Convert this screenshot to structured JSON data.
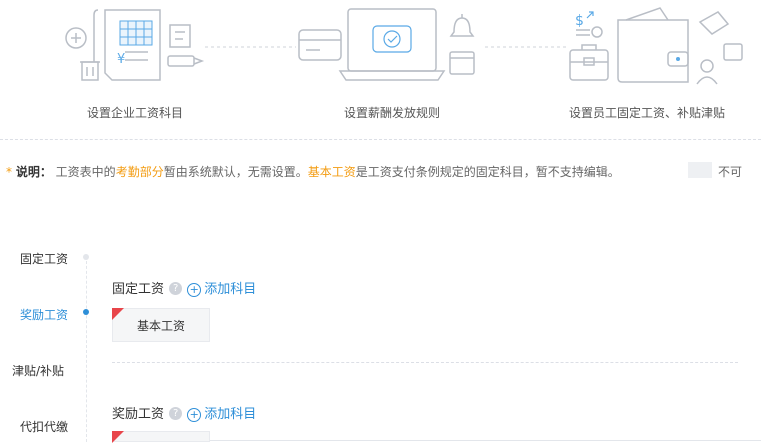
{
  "steps": [
    {
      "label": "设置企业工资科目"
    },
    {
      "label": "设置薪酬发放规则"
    },
    {
      "label": "设置员工固定工资、补贴津贴"
    }
  ],
  "note": {
    "star": "*",
    "label": "说明：",
    "p1": "工资表中的",
    "h1": "考勤部分",
    "p2": "暂由系统默认，无需设置。",
    "h2": "基本工资",
    "p3": "是工资支付条例规定的固定科目，暂不支持编辑。",
    "p4": "不可"
  },
  "sidebar": {
    "items": [
      {
        "label": "固定工资"
      },
      {
        "label": "奖励工资"
      },
      {
        "label": "津贴/补贴"
      },
      {
        "label": "代扣代缴"
      }
    ]
  },
  "sections": [
    {
      "title": "固定工资",
      "help": "?",
      "add_label": "添加科目",
      "tags": [
        "基本工资"
      ]
    },
    {
      "title": "奖励工资",
      "help": "?",
      "add_label": "添加科目",
      "tags": [
        ""
      ]
    }
  ],
  "colors": {
    "accent": "#2e8fd8",
    "highlight": "#f39c12",
    "corner": "#e8454a"
  }
}
